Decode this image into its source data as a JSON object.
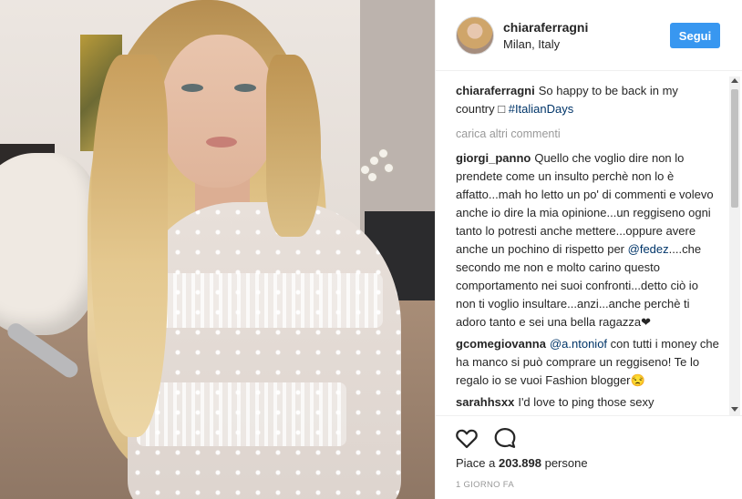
{
  "header": {
    "username": "chiaraferragni",
    "location": "Milan, Italy",
    "follow_label": "Segui"
  },
  "caption": {
    "author": "chiaraferragni",
    "text": "So happy to be back in my country □ ",
    "hashtag": "#ItalianDays"
  },
  "load_more_label": "carica altri commenti",
  "comments": [
    {
      "author": "giorgi_panno",
      "text_before": "Quello che voglio dire non lo prendete come un insulto perchè non lo è affatto...mah ho letto un po' di commenti e volevo anche io dire la mia opinione...un reggiseno ogni tanto lo potresti anche mettere...oppure avere anche un pochino di rispetto per ",
      "mention": "@fedez",
      "text_after": "....che secondo me non e molto carino questo comportamento nei suoi confronti...detto ciò io non ti voglio insultare...anzi...anche perchè ti adoro tanto e sei una bella ragazza❤"
    },
    {
      "author": "gcomegiovanna",
      "mention": "@a.ntoniof",
      "text_after": " con tutti i money che ha manco si può comprare un reggiseno! Te lo regalo io se vuoi Fashion blogger😒"
    },
    {
      "author": "sarahhsxx",
      "text_before": "I'd love to ping those sexy"
    }
  ],
  "actions": {
    "like_icon": "heart-outline-icon",
    "comment_icon": "speech-bubble-icon"
  },
  "likes": {
    "prefix": "Piace a ",
    "count": "203.898",
    "suffix": " persone"
  },
  "timestamp": "1 GIORNO FA",
  "colors": {
    "follow_button": "#3897f0",
    "mention": "#003569",
    "muted": "#999999",
    "text": "#262626"
  }
}
